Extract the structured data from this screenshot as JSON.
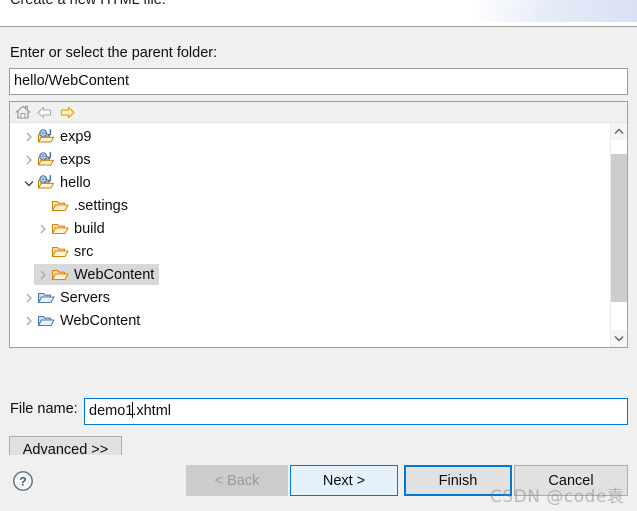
{
  "window": {
    "title": "Create a new HTML file.",
    "banner_icon": "wizard-banner-image"
  },
  "form": {
    "parent_folder_label": "Enter or select the parent folder:",
    "parent_folder_value": "hello/WebContent",
    "file_name_label": "File name:",
    "file_name_value_before_caret": "demo1",
    "file_name_value_after_caret": ".xhtml",
    "file_name_value": "demo1.xhtml",
    "advanced_label": "Advanced >>"
  },
  "tree_toolbar": {
    "home_icon": "home-icon",
    "back_icon": "back-arrow-icon",
    "forward_icon": "forward-arrow-icon"
  },
  "tree": {
    "rows": [
      {
        "label": "exp9",
        "indent": 0,
        "twisty": "collapsed",
        "icon": "java-web-project-icon",
        "selected": false
      },
      {
        "label": "exps",
        "indent": 0,
        "twisty": "collapsed",
        "icon": "java-web-project-icon",
        "selected": false
      },
      {
        "label": "hello",
        "indent": 0,
        "twisty": "expanded",
        "icon": "java-web-project-icon",
        "selected": false
      },
      {
        "label": ".settings",
        "indent": 1,
        "twisty": "none",
        "icon": "folder-orange-icon",
        "selected": false
      },
      {
        "label": "build",
        "indent": 1,
        "twisty": "collapsed",
        "icon": "folder-orange-icon",
        "selected": false
      },
      {
        "label": "src",
        "indent": 1,
        "twisty": "none",
        "icon": "folder-orange-icon",
        "selected": false
      },
      {
        "label": "WebContent",
        "indent": 1,
        "twisty": "collapsed",
        "icon": "folder-orange-icon",
        "selected": true
      },
      {
        "label": "Servers",
        "indent": 0,
        "twisty": "collapsed",
        "icon": "folder-blue-icon",
        "selected": false
      },
      {
        "label": "WebContent",
        "indent": 0,
        "twisty": "collapsed",
        "icon": "folder-blue-icon",
        "selected": false
      }
    ]
  },
  "scrollbar": {
    "up_icon": "chevron-up-icon",
    "down_icon": "chevron-down-icon"
  },
  "footer": {
    "help_icon": "help-question-icon",
    "back_label": "< Back",
    "next_label": "Next >",
    "finish_label": "Finish",
    "cancel_label": "Cancel"
  },
  "watermark": {
    "text": "CSDN @code袁"
  },
  "colors": {
    "accent_blue": "#0078d7",
    "hover_blue": "#e5f1fb",
    "selection_gray": "#d8d8d8",
    "dialog_bg": "#f0f0f0",
    "button_bg": "#e1e1e1"
  }
}
